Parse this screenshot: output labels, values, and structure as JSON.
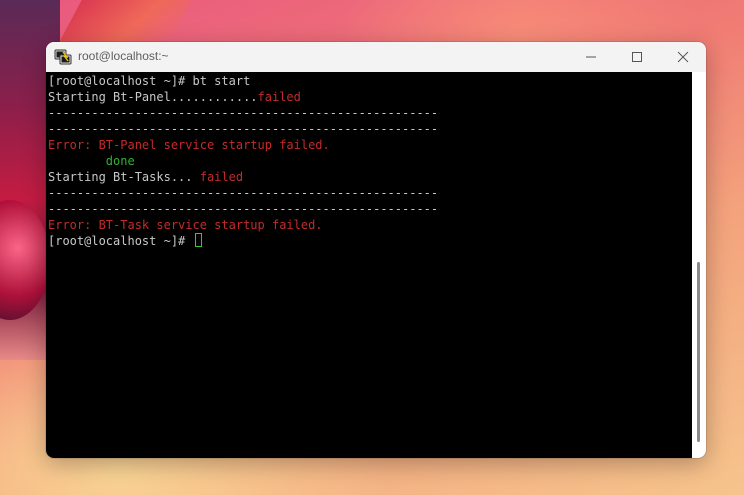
{
  "window": {
    "title": "root@localhost:~",
    "app_icon": "putty-icon"
  },
  "controls": {
    "minimize_icon": "minimize-icon",
    "maximize_icon": "maximize-icon",
    "close_icon": "close-icon"
  },
  "terminal": {
    "lines": [
      {
        "text": "[root@localhost ~]# bt start",
        "segments": [
          {
            "text": "[root@localhost ~]# bt start",
            "color": "default"
          }
        ]
      },
      {
        "segments": [
          {
            "text": "Starting Bt-Panel............",
            "color": "default"
          },
          {
            "text": "failed",
            "color": "red"
          }
        ]
      },
      {
        "segments": [
          {
            "text": "------------------------------------------------------",
            "color": "default"
          }
        ]
      },
      {
        "segments": [
          {
            "text": "------------------------------------------------------",
            "color": "default"
          }
        ]
      },
      {
        "segments": [
          {
            "text": "Error: BT-Panel service startup failed.",
            "color": "red"
          }
        ]
      },
      {
        "segments": [
          {
            "text": "        done",
            "color": "green"
          }
        ]
      },
      {
        "segments": [
          {
            "text": "Starting Bt-Tasks... ",
            "color": "default"
          },
          {
            "text": "failed",
            "color": "red"
          }
        ]
      },
      {
        "segments": [
          {
            "text": "------------------------------------------------------",
            "color": "default"
          }
        ]
      },
      {
        "segments": [
          {
            "text": "------------------------------------------------------",
            "color": "default"
          }
        ]
      },
      {
        "segments": [
          {
            "text": "Error: BT-Task service startup failed.",
            "color": "red"
          }
        ]
      },
      {
        "segments": [
          {
            "text": "[root@localhost ~]# ",
            "color": "default"
          }
        ],
        "cursor": true
      }
    ]
  },
  "colors": {
    "terminal_bg": "#000000",
    "text_default": "#c8c8c8",
    "text_red": "#c32b2b",
    "text_green": "#33b033",
    "cursor": "#33cc33"
  }
}
